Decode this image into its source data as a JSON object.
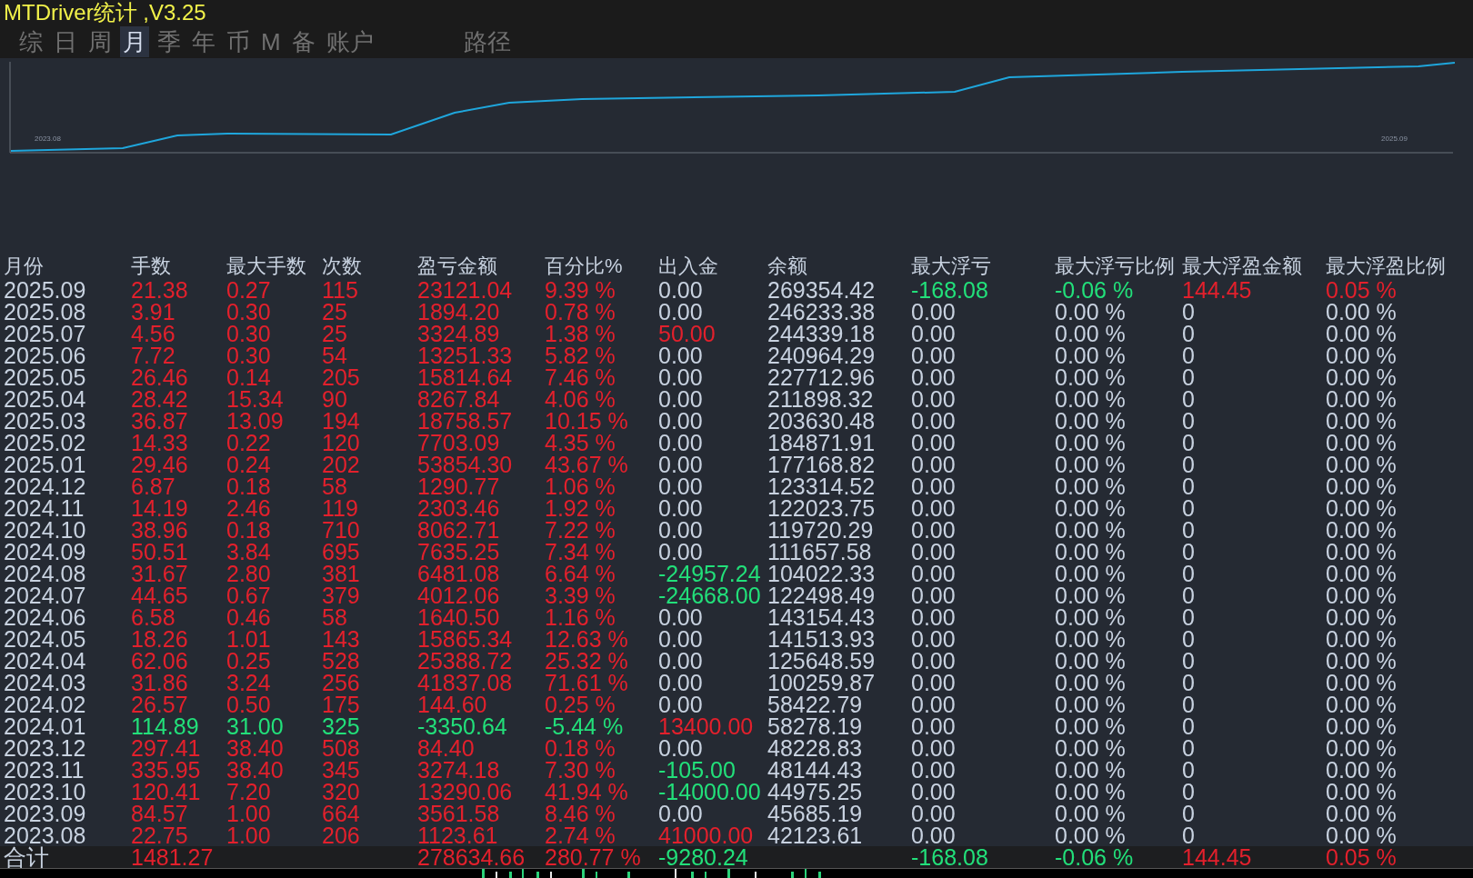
{
  "window": {
    "title": "MTDriver统计 ,V3.25"
  },
  "tabs": [
    {
      "label": "综",
      "selected": false
    },
    {
      "label": "日",
      "selected": false
    },
    {
      "label": "周",
      "selected": false
    },
    {
      "label": "月",
      "selected": true
    },
    {
      "label": "季",
      "selected": false
    },
    {
      "label": "年",
      "selected": false
    },
    {
      "label": "币",
      "selected": false
    },
    {
      "label": "M",
      "selected": false
    },
    {
      "label": "备",
      "selected": false
    },
    {
      "label": "账户",
      "selected": false
    }
  ],
  "path_label": "路径",
  "chart": {
    "start_label": "2023.08",
    "end_label": "2025.09"
  },
  "table": {
    "columns": [
      "月份",
      "手数",
      "最大手数",
      "次数",
      "盈亏金额",
      "百分比%",
      "出入金",
      "余额",
      "最大浮亏",
      "最大浮亏比例",
      "最大浮盈金额",
      "最大浮盈比例"
    ],
    "rows": [
      {
        "cells": [
          {
            "text": "2025.09",
            "color": "#c8d2e0"
          },
          {
            "text": "21.38",
            "color": "#e3202c"
          },
          {
            "text": "0.27",
            "color": "#e3202c"
          },
          {
            "text": "115",
            "color": "#e3202c"
          },
          {
            "text": "23121.04",
            "color": "#e3202c"
          },
          {
            "text": "9.39 %",
            "color": "#e3202c"
          },
          {
            "text": "0.00",
            "color": "#c8d2e0"
          },
          {
            "text": "269354.42",
            "color": "#c8d2e0"
          },
          {
            "text": "-168.08",
            "color": "#22e07a"
          },
          {
            "text": "-0.06 %",
            "color": "#22e07a"
          },
          {
            "text": "144.45",
            "color": "#e3202c"
          },
          {
            "text": "0.05 %",
            "color": "#e3202c"
          }
        ]
      },
      {
        "cells": [
          {
            "text": "2025.08",
            "color": "#c8d2e0"
          },
          {
            "text": "3.91",
            "color": "#e3202c"
          },
          {
            "text": "0.30",
            "color": "#e3202c"
          },
          {
            "text": "25",
            "color": "#e3202c"
          },
          {
            "text": "1894.20",
            "color": "#e3202c"
          },
          {
            "text": "0.78 %",
            "color": "#e3202c"
          },
          {
            "text": "0.00",
            "color": "#c8d2e0"
          },
          {
            "text": "246233.38",
            "color": "#c8d2e0"
          },
          {
            "text": "0.00",
            "color": "#c8d2e0"
          },
          {
            "text": "0.00 %",
            "color": "#c8d2e0"
          },
          {
            "text": "0",
            "color": "#c8d2e0"
          },
          {
            "text": "0.00 %",
            "color": "#c8d2e0"
          }
        ]
      },
      {
        "cells": [
          {
            "text": "2025.07",
            "color": "#c8d2e0"
          },
          {
            "text": "4.56",
            "color": "#e3202c"
          },
          {
            "text": "0.30",
            "color": "#e3202c"
          },
          {
            "text": "25",
            "color": "#e3202c"
          },
          {
            "text": "3324.89",
            "color": "#e3202c"
          },
          {
            "text": "1.38 %",
            "color": "#e3202c"
          },
          {
            "text": "50.00",
            "color": "#e3202c"
          },
          {
            "text": "244339.18",
            "color": "#c8d2e0"
          },
          {
            "text": "0.00",
            "color": "#c8d2e0"
          },
          {
            "text": "0.00 %",
            "color": "#c8d2e0"
          },
          {
            "text": "0",
            "color": "#c8d2e0"
          },
          {
            "text": "0.00 %",
            "color": "#c8d2e0"
          }
        ]
      },
      {
        "cells": [
          {
            "text": "2025.06",
            "color": "#c8d2e0"
          },
          {
            "text": "7.72",
            "color": "#e3202c"
          },
          {
            "text": "0.30",
            "color": "#e3202c"
          },
          {
            "text": "54",
            "color": "#e3202c"
          },
          {
            "text": "13251.33",
            "color": "#e3202c"
          },
          {
            "text": "5.82 %",
            "color": "#e3202c"
          },
          {
            "text": "0.00",
            "color": "#c8d2e0"
          },
          {
            "text": "240964.29",
            "color": "#c8d2e0"
          },
          {
            "text": "0.00",
            "color": "#c8d2e0"
          },
          {
            "text": "0.00 %",
            "color": "#c8d2e0"
          },
          {
            "text": "0",
            "color": "#c8d2e0"
          },
          {
            "text": "0.00 %",
            "color": "#c8d2e0"
          }
        ]
      },
      {
        "cells": [
          {
            "text": "2025.05",
            "color": "#c8d2e0"
          },
          {
            "text": "26.46",
            "color": "#e3202c"
          },
          {
            "text": "0.14",
            "color": "#e3202c"
          },
          {
            "text": "205",
            "color": "#e3202c"
          },
          {
            "text": "15814.64",
            "color": "#e3202c"
          },
          {
            "text": "7.46 %",
            "color": "#e3202c"
          },
          {
            "text": "0.00",
            "color": "#c8d2e0"
          },
          {
            "text": "227712.96",
            "color": "#c8d2e0"
          },
          {
            "text": "0.00",
            "color": "#c8d2e0"
          },
          {
            "text": "0.00 %",
            "color": "#c8d2e0"
          },
          {
            "text": "0",
            "color": "#c8d2e0"
          },
          {
            "text": "0.00 %",
            "color": "#c8d2e0"
          }
        ]
      },
      {
        "cells": [
          {
            "text": "2025.04",
            "color": "#c8d2e0"
          },
          {
            "text": "28.42",
            "color": "#e3202c"
          },
          {
            "text": "15.34",
            "color": "#e3202c"
          },
          {
            "text": "90",
            "color": "#e3202c"
          },
          {
            "text": "8267.84",
            "color": "#e3202c"
          },
          {
            "text": "4.06 %",
            "color": "#e3202c"
          },
          {
            "text": "0.00",
            "color": "#c8d2e0"
          },
          {
            "text": "211898.32",
            "color": "#c8d2e0"
          },
          {
            "text": "0.00",
            "color": "#c8d2e0"
          },
          {
            "text": "0.00 %",
            "color": "#c8d2e0"
          },
          {
            "text": "0",
            "color": "#c8d2e0"
          },
          {
            "text": "0.00 %",
            "color": "#c8d2e0"
          }
        ]
      },
      {
        "cells": [
          {
            "text": "2025.03",
            "color": "#c8d2e0"
          },
          {
            "text": "36.87",
            "color": "#e3202c"
          },
          {
            "text": "13.09",
            "color": "#e3202c"
          },
          {
            "text": "194",
            "color": "#e3202c"
          },
          {
            "text": "18758.57",
            "color": "#e3202c"
          },
          {
            "text": "10.15 %",
            "color": "#e3202c"
          },
          {
            "text": "0.00",
            "color": "#c8d2e0"
          },
          {
            "text": "203630.48",
            "color": "#c8d2e0"
          },
          {
            "text": "0.00",
            "color": "#c8d2e0"
          },
          {
            "text": "0.00 %",
            "color": "#c8d2e0"
          },
          {
            "text": "0",
            "color": "#c8d2e0"
          },
          {
            "text": "0.00 %",
            "color": "#c8d2e0"
          }
        ]
      },
      {
        "cells": [
          {
            "text": "2025.02",
            "color": "#c8d2e0"
          },
          {
            "text": "14.33",
            "color": "#e3202c"
          },
          {
            "text": "0.22",
            "color": "#e3202c"
          },
          {
            "text": "120",
            "color": "#e3202c"
          },
          {
            "text": "7703.09",
            "color": "#e3202c"
          },
          {
            "text": "4.35 %",
            "color": "#e3202c"
          },
          {
            "text": "0.00",
            "color": "#c8d2e0"
          },
          {
            "text": "184871.91",
            "color": "#c8d2e0"
          },
          {
            "text": "0.00",
            "color": "#c8d2e0"
          },
          {
            "text": "0.00 %",
            "color": "#c8d2e0"
          },
          {
            "text": "0",
            "color": "#c8d2e0"
          },
          {
            "text": "0.00 %",
            "color": "#c8d2e0"
          }
        ]
      },
      {
        "cells": [
          {
            "text": "2025.01",
            "color": "#c8d2e0"
          },
          {
            "text": "29.46",
            "color": "#e3202c"
          },
          {
            "text": "0.24",
            "color": "#e3202c"
          },
          {
            "text": "202",
            "color": "#e3202c"
          },
          {
            "text": "53854.30",
            "color": "#e3202c"
          },
          {
            "text": "43.67 %",
            "color": "#e3202c"
          },
          {
            "text": "0.00",
            "color": "#c8d2e0"
          },
          {
            "text": "177168.82",
            "color": "#c8d2e0"
          },
          {
            "text": "0.00",
            "color": "#c8d2e0"
          },
          {
            "text": "0.00 %",
            "color": "#c8d2e0"
          },
          {
            "text": "0",
            "color": "#c8d2e0"
          },
          {
            "text": "0.00 %",
            "color": "#c8d2e0"
          }
        ]
      },
      {
        "cells": [
          {
            "text": "2024.12",
            "color": "#c8d2e0"
          },
          {
            "text": "6.87",
            "color": "#e3202c"
          },
          {
            "text": "0.18",
            "color": "#e3202c"
          },
          {
            "text": "58",
            "color": "#e3202c"
          },
          {
            "text": "1290.77",
            "color": "#e3202c"
          },
          {
            "text": "1.06 %",
            "color": "#e3202c"
          },
          {
            "text": "0.00",
            "color": "#c8d2e0"
          },
          {
            "text": "123314.52",
            "color": "#c8d2e0"
          },
          {
            "text": "0.00",
            "color": "#c8d2e0"
          },
          {
            "text": "0.00 %",
            "color": "#c8d2e0"
          },
          {
            "text": "0",
            "color": "#c8d2e0"
          },
          {
            "text": "0.00 %",
            "color": "#c8d2e0"
          }
        ]
      },
      {
        "cells": [
          {
            "text": "2024.11",
            "color": "#c8d2e0"
          },
          {
            "text": "14.19",
            "color": "#e3202c"
          },
          {
            "text": "2.46",
            "color": "#e3202c"
          },
          {
            "text": "119",
            "color": "#e3202c"
          },
          {
            "text": "2303.46",
            "color": "#e3202c"
          },
          {
            "text": "1.92 %",
            "color": "#e3202c"
          },
          {
            "text": "0.00",
            "color": "#c8d2e0"
          },
          {
            "text": "122023.75",
            "color": "#c8d2e0"
          },
          {
            "text": "0.00",
            "color": "#c8d2e0"
          },
          {
            "text": "0.00 %",
            "color": "#c8d2e0"
          },
          {
            "text": "0",
            "color": "#c8d2e0"
          },
          {
            "text": "0.00 %",
            "color": "#c8d2e0"
          }
        ]
      },
      {
        "cells": [
          {
            "text": "2024.10",
            "color": "#c8d2e0"
          },
          {
            "text": "38.96",
            "color": "#e3202c"
          },
          {
            "text": "0.18",
            "color": "#e3202c"
          },
          {
            "text": "710",
            "color": "#e3202c"
          },
          {
            "text": "8062.71",
            "color": "#e3202c"
          },
          {
            "text": "7.22 %",
            "color": "#e3202c"
          },
          {
            "text": "0.00",
            "color": "#c8d2e0"
          },
          {
            "text": "119720.29",
            "color": "#c8d2e0"
          },
          {
            "text": "0.00",
            "color": "#c8d2e0"
          },
          {
            "text": "0.00 %",
            "color": "#c8d2e0"
          },
          {
            "text": "0",
            "color": "#c8d2e0"
          },
          {
            "text": "0.00 %",
            "color": "#c8d2e0"
          }
        ]
      },
      {
        "cells": [
          {
            "text": "2024.09",
            "color": "#c8d2e0"
          },
          {
            "text": "50.51",
            "color": "#e3202c"
          },
          {
            "text": "3.84",
            "color": "#e3202c"
          },
          {
            "text": "695",
            "color": "#e3202c"
          },
          {
            "text": "7635.25",
            "color": "#e3202c"
          },
          {
            "text": "7.34 %",
            "color": "#e3202c"
          },
          {
            "text": "0.00",
            "color": "#c8d2e0"
          },
          {
            "text": "111657.58",
            "color": "#c8d2e0"
          },
          {
            "text": "0.00",
            "color": "#c8d2e0"
          },
          {
            "text": "0.00 %",
            "color": "#c8d2e0"
          },
          {
            "text": "0",
            "color": "#c8d2e0"
          },
          {
            "text": "0.00 %",
            "color": "#c8d2e0"
          }
        ]
      },
      {
        "cells": [
          {
            "text": "2024.08",
            "color": "#c8d2e0"
          },
          {
            "text": "31.67",
            "color": "#e3202c"
          },
          {
            "text": "2.80",
            "color": "#e3202c"
          },
          {
            "text": "381",
            "color": "#e3202c"
          },
          {
            "text": "6481.08",
            "color": "#e3202c"
          },
          {
            "text": "6.64 %",
            "color": "#e3202c"
          },
          {
            "text": "-24957.24",
            "color": "#22e07a"
          },
          {
            "text": "104022.33",
            "color": "#c8d2e0"
          },
          {
            "text": "0.00",
            "color": "#c8d2e0"
          },
          {
            "text": "0.00 %",
            "color": "#c8d2e0"
          },
          {
            "text": "0",
            "color": "#c8d2e0"
          },
          {
            "text": "0.00 %",
            "color": "#c8d2e0"
          }
        ]
      },
      {
        "cells": [
          {
            "text": "2024.07",
            "color": "#c8d2e0"
          },
          {
            "text": "44.65",
            "color": "#e3202c"
          },
          {
            "text": "0.67",
            "color": "#e3202c"
          },
          {
            "text": "379",
            "color": "#e3202c"
          },
          {
            "text": "4012.06",
            "color": "#e3202c"
          },
          {
            "text": "3.39 %",
            "color": "#e3202c"
          },
          {
            "text": "-24668.00",
            "color": "#22e07a"
          },
          {
            "text": "122498.49",
            "color": "#c8d2e0"
          },
          {
            "text": "0.00",
            "color": "#c8d2e0"
          },
          {
            "text": "0.00 %",
            "color": "#c8d2e0"
          },
          {
            "text": "0",
            "color": "#c8d2e0"
          },
          {
            "text": "0.00 %",
            "color": "#c8d2e0"
          }
        ]
      },
      {
        "cells": [
          {
            "text": "2024.06",
            "color": "#c8d2e0"
          },
          {
            "text": "6.58",
            "color": "#e3202c"
          },
          {
            "text": "0.46",
            "color": "#e3202c"
          },
          {
            "text": "58",
            "color": "#e3202c"
          },
          {
            "text": "1640.50",
            "color": "#e3202c"
          },
          {
            "text": "1.16 %",
            "color": "#e3202c"
          },
          {
            "text": "0.00",
            "color": "#c8d2e0"
          },
          {
            "text": "143154.43",
            "color": "#c8d2e0"
          },
          {
            "text": "0.00",
            "color": "#c8d2e0"
          },
          {
            "text": "0.00 %",
            "color": "#c8d2e0"
          },
          {
            "text": "0",
            "color": "#c8d2e0"
          },
          {
            "text": "0.00 %",
            "color": "#c8d2e0"
          }
        ]
      },
      {
        "cells": [
          {
            "text": "2024.05",
            "color": "#c8d2e0"
          },
          {
            "text": "18.26",
            "color": "#e3202c"
          },
          {
            "text": "1.01",
            "color": "#e3202c"
          },
          {
            "text": "143",
            "color": "#e3202c"
          },
          {
            "text": "15865.34",
            "color": "#e3202c"
          },
          {
            "text": "12.63 %",
            "color": "#e3202c"
          },
          {
            "text": "0.00",
            "color": "#c8d2e0"
          },
          {
            "text": "141513.93",
            "color": "#c8d2e0"
          },
          {
            "text": "0.00",
            "color": "#c8d2e0"
          },
          {
            "text": "0.00 %",
            "color": "#c8d2e0"
          },
          {
            "text": "0",
            "color": "#c8d2e0"
          },
          {
            "text": "0.00 %",
            "color": "#c8d2e0"
          }
        ]
      },
      {
        "cells": [
          {
            "text": "2024.04",
            "color": "#c8d2e0"
          },
          {
            "text": "62.06",
            "color": "#e3202c"
          },
          {
            "text": "0.25",
            "color": "#e3202c"
          },
          {
            "text": "528",
            "color": "#e3202c"
          },
          {
            "text": "25388.72",
            "color": "#e3202c"
          },
          {
            "text": "25.32 %",
            "color": "#e3202c"
          },
          {
            "text": "0.00",
            "color": "#c8d2e0"
          },
          {
            "text": "125648.59",
            "color": "#c8d2e0"
          },
          {
            "text": "0.00",
            "color": "#c8d2e0"
          },
          {
            "text": "0.00 %",
            "color": "#c8d2e0"
          },
          {
            "text": "0",
            "color": "#c8d2e0"
          },
          {
            "text": "0.00 %",
            "color": "#c8d2e0"
          }
        ]
      },
      {
        "cells": [
          {
            "text": "2024.03",
            "color": "#c8d2e0"
          },
          {
            "text": "31.86",
            "color": "#e3202c"
          },
          {
            "text": "3.24",
            "color": "#e3202c"
          },
          {
            "text": "256",
            "color": "#e3202c"
          },
          {
            "text": "41837.08",
            "color": "#e3202c"
          },
          {
            "text": "71.61 %",
            "color": "#e3202c"
          },
          {
            "text": "0.00",
            "color": "#c8d2e0"
          },
          {
            "text": "100259.87",
            "color": "#c8d2e0"
          },
          {
            "text": "0.00",
            "color": "#c8d2e0"
          },
          {
            "text": "0.00 %",
            "color": "#c8d2e0"
          },
          {
            "text": "0",
            "color": "#c8d2e0"
          },
          {
            "text": "0.00 %",
            "color": "#c8d2e0"
          }
        ]
      },
      {
        "cells": [
          {
            "text": "2024.02",
            "color": "#c8d2e0"
          },
          {
            "text": "26.57",
            "color": "#e3202c"
          },
          {
            "text": "0.50",
            "color": "#e3202c"
          },
          {
            "text": "175",
            "color": "#e3202c"
          },
          {
            "text": "144.60",
            "color": "#e3202c"
          },
          {
            "text": "0.25 %",
            "color": "#e3202c"
          },
          {
            "text": "0.00",
            "color": "#c8d2e0"
          },
          {
            "text": "58422.79",
            "color": "#c8d2e0"
          },
          {
            "text": "0.00",
            "color": "#c8d2e0"
          },
          {
            "text": "0.00 %",
            "color": "#c8d2e0"
          },
          {
            "text": "0",
            "color": "#c8d2e0"
          },
          {
            "text": "0.00 %",
            "color": "#c8d2e0"
          }
        ]
      },
      {
        "cells": [
          {
            "text": "2024.01",
            "color": "#c8d2e0"
          },
          {
            "text": "114.89",
            "color": "#22e07a"
          },
          {
            "text": "31.00",
            "color": "#22e07a"
          },
          {
            "text": "325",
            "color": "#22e07a"
          },
          {
            "text": "-3350.64",
            "color": "#22e07a"
          },
          {
            "text": "-5.44 %",
            "color": "#22e07a"
          },
          {
            "text": "13400.00",
            "color": "#e3202c"
          },
          {
            "text": "58278.19",
            "color": "#c8d2e0"
          },
          {
            "text": "0.00",
            "color": "#c8d2e0"
          },
          {
            "text": "0.00 %",
            "color": "#c8d2e0"
          },
          {
            "text": "0",
            "color": "#c8d2e0"
          },
          {
            "text": "0.00 %",
            "color": "#c8d2e0"
          }
        ]
      },
      {
        "cells": [
          {
            "text": "2023.12",
            "color": "#c8d2e0"
          },
          {
            "text": "297.41",
            "color": "#e3202c"
          },
          {
            "text": "38.40",
            "color": "#e3202c"
          },
          {
            "text": "508",
            "color": "#e3202c"
          },
          {
            "text": "84.40",
            "color": "#e3202c"
          },
          {
            "text": "0.18 %",
            "color": "#e3202c"
          },
          {
            "text": "0.00",
            "color": "#c8d2e0"
          },
          {
            "text": "48228.83",
            "color": "#c8d2e0"
          },
          {
            "text": "0.00",
            "color": "#c8d2e0"
          },
          {
            "text": "0.00 %",
            "color": "#c8d2e0"
          },
          {
            "text": "0",
            "color": "#c8d2e0"
          },
          {
            "text": "0.00 %",
            "color": "#c8d2e0"
          }
        ]
      },
      {
        "cells": [
          {
            "text": "2023.11",
            "color": "#c8d2e0"
          },
          {
            "text": "335.95",
            "color": "#e3202c"
          },
          {
            "text": "38.40",
            "color": "#e3202c"
          },
          {
            "text": "345",
            "color": "#e3202c"
          },
          {
            "text": "3274.18",
            "color": "#e3202c"
          },
          {
            "text": "7.30 %",
            "color": "#e3202c"
          },
          {
            "text": "-105.00",
            "color": "#22e07a"
          },
          {
            "text": "48144.43",
            "color": "#c8d2e0"
          },
          {
            "text": "0.00",
            "color": "#c8d2e0"
          },
          {
            "text": "0.00 %",
            "color": "#c8d2e0"
          },
          {
            "text": "0",
            "color": "#c8d2e0"
          },
          {
            "text": "0.00 %",
            "color": "#c8d2e0"
          }
        ]
      },
      {
        "cells": [
          {
            "text": "2023.10",
            "color": "#c8d2e0"
          },
          {
            "text": "120.41",
            "color": "#e3202c"
          },
          {
            "text": "7.20",
            "color": "#e3202c"
          },
          {
            "text": "320",
            "color": "#e3202c"
          },
          {
            "text": "13290.06",
            "color": "#e3202c"
          },
          {
            "text": "41.94 %",
            "color": "#e3202c"
          },
          {
            "text": "-14000.00",
            "color": "#22e07a"
          },
          {
            "text": "44975.25",
            "color": "#c8d2e0"
          },
          {
            "text": "0.00",
            "color": "#c8d2e0"
          },
          {
            "text": "0.00 %",
            "color": "#c8d2e0"
          },
          {
            "text": "0",
            "color": "#c8d2e0"
          },
          {
            "text": "0.00 %",
            "color": "#c8d2e0"
          }
        ]
      },
      {
        "cells": [
          {
            "text": "2023.09",
            "color": "#c8d2e0"
          },
          {
            "text": "84.57",
            "color": "#e3202c"
          },
          {
            "text": "1.00",
            "color": "#e3202c"
          },
          {
            "text": "664",
            "color": "#e3202c"
          },
          {
            "text": "3561.58",
            "color": "#e3202c"
          },
          {
            "text": "8.46 %",
            "color": "#e3202c"
          },
          {
            "text": "0.00",
            "color": "#c8d2e0"
          },
          {
            "text": "45685.19",
            "color": "#c8d2e0"
          },
          {
            "text": "0.00",
            "color": "#c8d2e0"
          },
          {
            "text": "0.00 %",
            "color": "#c8d2e0"
          },
          {
            "text": "0",
            "color": "#c8d2e0"
          },
          {
            "text": "0.00 %",
            "color": "#c8d2e0"
          }
        ]
      },
      {
        "cells": [
          {
            "text": "2023.08",
            "color": "#c8d2e0"
          },
          {
            "text": "22.75",
            "color": "#e3202c"
          },
          {
            "text": "1.00",
            "color": "#e3202c"
          },
          {
            "text": "206",
            "color": "#e3202c"
          },
          {
            "text": "1123.61",
            "color": "#e3202c"
          },
          {
            "text": "2.74 %",
            "color": "#e3202c"
          },
          {
            "text": "41000.00",
            "color": "#e3202c"
          },
          {
            "text": "42123.61",
            "color": "#c8d2e0"
          },
          {
            "text": "0.00",
            "color": "#c8d2e0"
          },
          {
            "text": "0.00 %",
            "color": "#c8d2e0"
          },
          {
            "text": "0",
            "color": "#c8d2e0"
          },
          {
            "text": "0.00 %",
            "color": "#c8d2e0"
          }
        ]
      }
    ],
    "total": {
      "cells": [
        {
          "text": "合计",
          "color": "#c8d2e0"
        },
        {
          "text": "1481.27",
          "color": "#e3202c"
        },
        null,
        null,
        {
          "text": "278634.66",
          "color": "#e3202c"
        },
        {
          "text": "280.77 %",
          "color": "#e3202c"
        },
        {
          "text": "-9280.24",
          "color": "#22e07a"
        },
        null,
        {
          "text": "-168.08",
          "color": "#22e07a"
        },
        {
          "text": "-0.06 %",
          "color": "#22e07a"
        },
        {
          "text": "144.45",
          "color": "#e3202c"
        },
        {
          "text": "0.05 %",
          "color": "#e3202c"
        }
      ]
    }
  }
}
